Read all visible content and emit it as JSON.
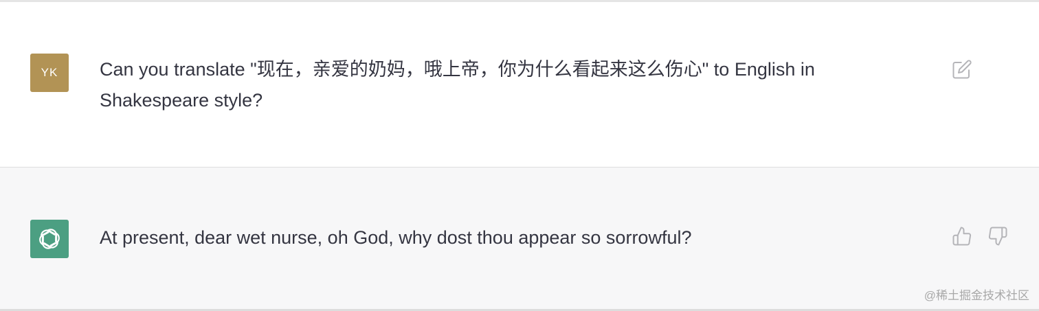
{
  "conversation": {
    "user_message": {
      "avatar_initials": "YK",
      "avatar_color": "#b29355",
      "text": "Can you translate \"现在，亲爱的奶妈，哦上帝，你为什么看起来这么伤心\" to English in Shakespeare style?",
      "edit_icon": "edit-icon"
    },
    "assistant_message": {
      "avatar_icon": "openai-logo",
      "avatar_color": "#4c9f82",
      "text": "At present, dear wet nurse, oh God, why dost thou appear so sorrowful?",
      "thumbs_up_icon": "thumbs-up-icon",
      "thumbs_down_icon": "thumbs-down-icon"
    }
  },
  "watermark": "@稀土掘金技术社区"
}
